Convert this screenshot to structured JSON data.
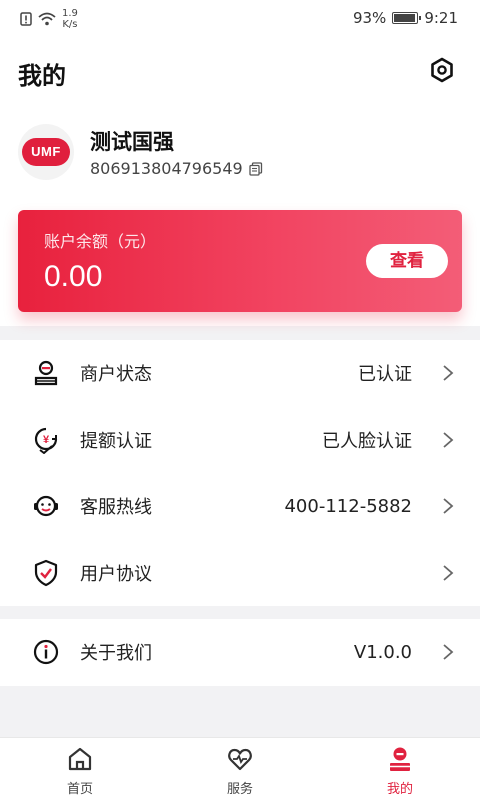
{
  "status_bar": {
    "speed_value": "1.9",
    "speed_unit": "K/s",
    "battery": "93%",
    "battery_level": 0.93,
    "time": "9:21"
  },
  "header": {
    "title": "我的",
    "settings_icon": "hexagon-settings-icon"
  },
  "user": {
    "avatar_logo": "UMF",
    "name": "测试国强",
    "id": "806913804796549",
    "copy_icon": "copy-icon"
  },
  "balance": {
    "label": "账户余额（元）",
    "value": "0.00",
    "button": "查看"
  },
  "menu": {
    "group1": [
      {
        "label": "商户状态",
        "value": "已认证",
        "icon": "merchant-status-icon"
      },
      {
        "label": "提额认证",
        "value": "已人脸认证",
        "icon": "limit-certification-icon"
      },
      {
        "label": "客服热线",
        "value": "400-112-5882",
        "icon": "customer-service-icon"
      },
      {
        "label": "用户协议",
        "value": "",
        "icon": "shield-check-icon"
      }
    ],
    "group2": [
      {
        "label": "关于我们",
        "value": "V1.0.0",
        "icon": "info-icon"
      }
    ]
  },
  "tabs": [
    {
      "label": "首页",
      "icon": "home-icon"
    },
    {
      "label": "服务",
      "icon": "heart-service-icon"
    },
    {
      "label": "我的",
      "icon": "mine-icon",
      "active": true
    }
  ],
  "colors": {
    "accent": "#e0223f",
    "background": "#f2f2f4"
  }
}
